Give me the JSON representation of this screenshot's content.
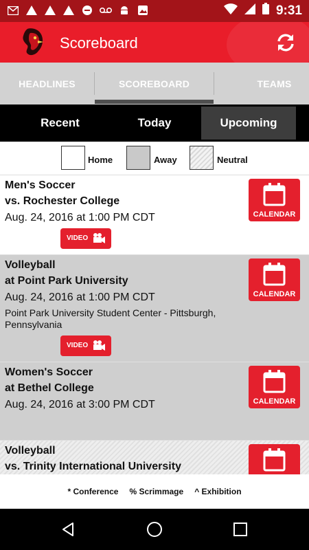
{
  "statusbar": {
    "time": "9:31"
  },
  "app": {
    "title": "Scoreboard"
  },
  "tabs": [
    {
      "label": "HEADLINES"
    },
    {
      "label": "SCOREBOARD"
    },
    {
      "label": "TEAMS"
    }
  ],
  "segments": [
    {
      "label": "Recent"
    },
    {
      "label": "Today"
    },
    {
      "label": "Upcoming"
    }
  ],
  "legend": {
    "home": "Home",
    "away": "Away",
    "neutral": "Neutral"
  },
  "events": [
    {
      "sport": "Men's Soccer",
      "opponent": "vs. Rochester College",
      "datetime": "Aug. 24, 2016 at 1:00 PM CDT",
      "location": "",
      "calendar_label": "CALENDAR",
      "video_label": "VIDEO"
    },
    {
      "sport": "Volleyball",
      "opponent": "at Point Park University",
      "datetime": "Aug. 24, 2016 at 1:00 PM CDT",
      "location": "Point Park University Student Center - Pittsburgh, Pennsylvania",
      "calendar_label": "CALENDAR",
      "video_label": "VIDEO"
    },
    {
      "sport": "Women's Soccer",
      "opponent": "at Bethel College",
      "datetime": "Aug. 24, 2016 at 3:00 PM CDT",
      "location": "",
      "calendar_label": "CALENDAR",
      "video_label": ""
    },
    {
      "sport": "Volleyball",
      "opponent": "vs. Trinity International University",
      "datetime": "",
      "location": "",
      "calendar_label": "",
      "video_label": ""
    }
  ],
  "footer": {
    "conference": "* Conference",
    "scrimmage": "% Scrimmage",
    "exhibition": "^ Exhibition"
  },
  "colors": {
    "primary": "#e91d2a",
    "status": "#a31419",
    "away_bg": "#cfcfcf",
    "neutral_bg": "#e6e6e6"
  },
  "icons": [
    "gmail-icon",
    "alert-icon",
    "alert-icon",
    "alert-icon",
    "blocked-icon",
    "voicemail-icon",
    "android-icon",
    "photo-icon",
    "wifi-icon",
    "signal-icon",
    "battery-icon",
    "refresh-icon",
    "calendar-icon",
    "video-camera-icon",
    "back-icon",
    "home-icon",
    "recents-icon"
  ]
}
